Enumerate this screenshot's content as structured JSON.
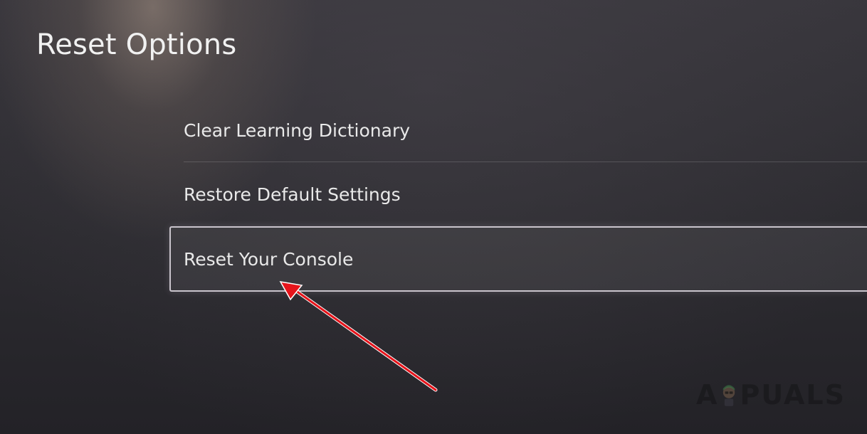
{
  "page": {
    "title": "Reset Options"
  },
  "menu": {
    "items": [
      {
        "label": "Clear Learning Dictionary"
      },
      {
        "label": "Restore Default Settings"
      },
      {
        "label": "Reset Your Console"
      }
    ]
  },
  "colors": {
    "arrow": "#e5141b",
    "focus_border": "#c9c4cc",
    "text": "#ececec"
  },
  "watermark": {
    "text_left": "A",
    "text_right": "PUALS"
  }
}
